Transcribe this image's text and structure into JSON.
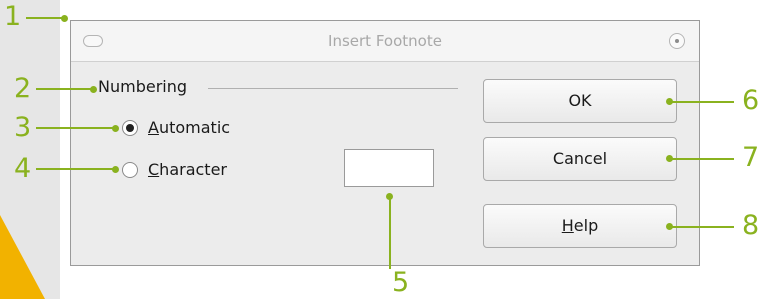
{
  "dialog": {
    "title": "Insert Footnote"
  },
  "numbering": {
    "group_label": "Numbering",
    "automatic": {
      "mnemonic": "A",
      "rest": "utomatic",
      "selected": true
    },
    "character": {
      "mnemonic": "C",
      "rest": "haracter",
      "selected": false
    },
    "character_value": ""
  },
  "buttons": {
    "ok": "OK",
    "cancel": "Cancel",
    "help_mnemonic": "H",
    "help_rest": "elp"
  },
  "callouts": [
    "1",
    "2",
    "3",
    "4",
    "5",
    "6",
    "7",
    "8"
  ],
  "colors": {
    "callout": "#8ab21f",
    "wedge": "#f2b200"
  }
}
